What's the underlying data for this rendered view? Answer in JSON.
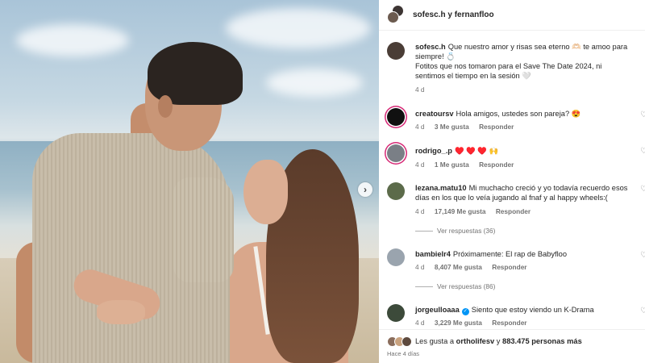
{
  "header": {
    "title": "sofesc.h y fernanfloo"
  },
  "caption": {
    "user": "sofesc.h",
    "text_line1": "Que nuestro amor y risas sea eterno 🫶🏻 te amoo para siempre! 💍",
    "text_line2": "Fotitos que nos tomaron para el Save The Date 2024, ni sentimos el tiempo en la sesión 🤍",
    "time": "4 d"
  },
  "comments": [
    {
      "user": "creatoursv",
      "text": "Hola amigos, ustedes son pareja? 😍",
      "time": "4 d",
      "likes": "3 Me gusta",
      "reply": "Responder"
    },
    {
      "user": "rodrigo_.p",
      "text": "♥️ ♥️ ♥️ 🙌",
      "time": "4 d",
      "likes": "1 Me gusta",
      "reply": "Responder"
    },
    {
      "user": "lezana.matu10",
      "text": "Mi muchacho creció y yo todavía recuerdo esos días en los que lo veía jugando al fnaf y al happy wheels:(",
      "time": "4 d",
      "likes": "17,149 Me gusta",
      "reply": "Responder",
      "view_replies": "Ver respuestas (36)"
    },
    {
      "user": "bambielr4",
      "text": "Próximamente: El rap de Babyfloo",
      "time": "4 d",
      "likes": "8,407 Me gusta",
      "reply": "Responder",
      "view_replies": "Ver respuestas (86)"
    },
    {
      "user": "jorgeulloaaa",
      "text": "Siento que estoy viendo un K-Drama",
      "time": "4 d",
      "likes": "3,229 Me gusta",
      "reply": "Responder"
    }
  ],
  "footer": {
    "likes_prefix": "Les gusta a",
    "likes_user": "ortholifesv",
    "likes_and": "y",
    "likes_count": "883.475 personas más",
    "time_ago": "Hace 4 días"
  },
  "colors": {
    "accent_blue": "#0095f6",
    "story_ring": "#d62976",
    "muted": "#737373"
  },
  "icons": {
    "carousel_next": "chevron-right-icon",
    "comment_like": "heart-outline-icon",
    "verified": "verified-badge-icon"
  }
}
